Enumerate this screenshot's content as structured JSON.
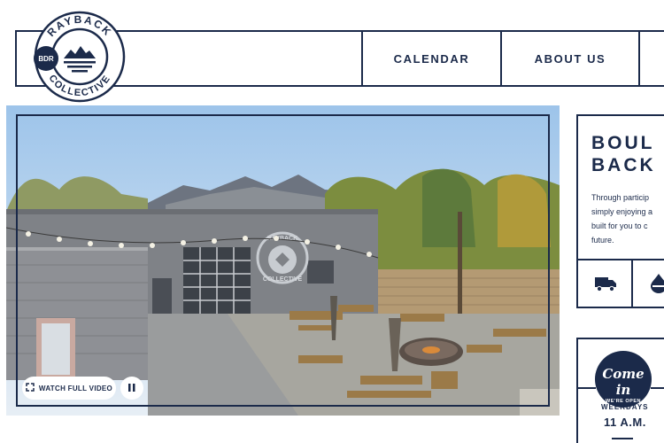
{
  "brand": {
    "name_top": "RAYBACK",
    "name_bottom": "COLLECTIVE",
    "badge": "BDR",
    "color_navy": "#1b2a4a"
  },
  "nav": {
    "items": [
      "CALENDAR",
      "ABOUT US"
    ]
  },
  "hero": {
    "watch_label": "WATCH FULL VIDEO",
    "watch_icon": "expand-icon",
    "pause_icon": "pause-icon",
    "mural_top": "RAYBACK",
    "mural_bottom": "COLLECTIVE"
  },
  "intro_card": {
    "title_line1": "BOUL",
    "title_line2": "BACK",
    "body_lines": [
      "Through particip",
      "simply enjoying a",
      "built for you to c",
      "future."
    ],
    "icons": [
      "food-truck-icon",
      "drop-icon"
    ]
  },
  "hours_card": {
    "badge_script": "Come in",
    "badge_small": "WE'RE OPEN",
    "weekdays_label": "WEEKDAYS",
    "open_time": "11 A.M."
  }
}
